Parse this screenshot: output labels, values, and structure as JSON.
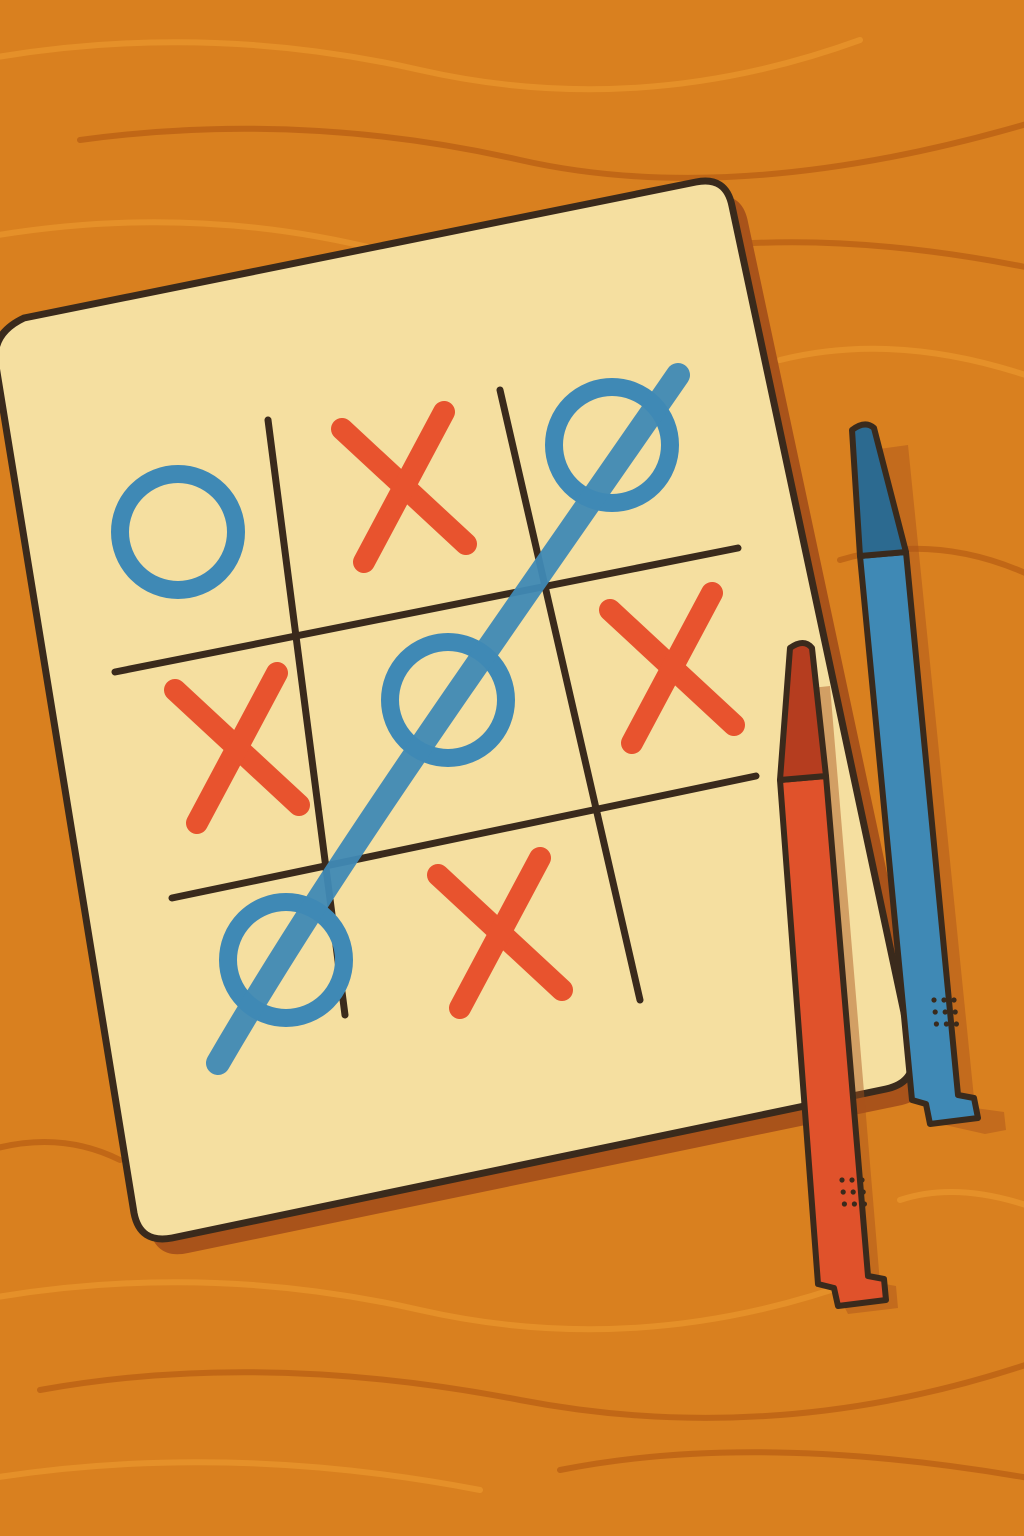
{
  "colors": {
    "table": "#d9801f",
    "table_dark": "#b85f14",
    "table_light": "#e8952e",
    "paper": "#f5dfa0",
    "paper_shadow": "#a9531a",
    "ink": "#3a2a1c",
    "x_mark": "#e8532e",
    "o_mark": "#3f89b5",
    "win_line": "#3f89b5",
    "pen_red": "#e0522b",
    "pen_red_dark": "#b53d1f",
    "pen_blue": "#3f89b5",
    "pen_blue_dark": "#2c6a90"
  },
  "game": {
    "board": [
      [
        "O",
        "X",
        "O"
      ],
      [
        "X",
        "O",
        "X"
      ],
      [
        "O",
        "X",
        ""
      ]
    ],
    "winner": "O",
    "winning_line": "anti-diagonal"
  },
  "props": [
    {
      "name": "red-marker",
      "color_key": "pen_red"
    },
    {
      "name": "blue-marker",
      "color_key": "pen_blue"
    }
  ]
}
